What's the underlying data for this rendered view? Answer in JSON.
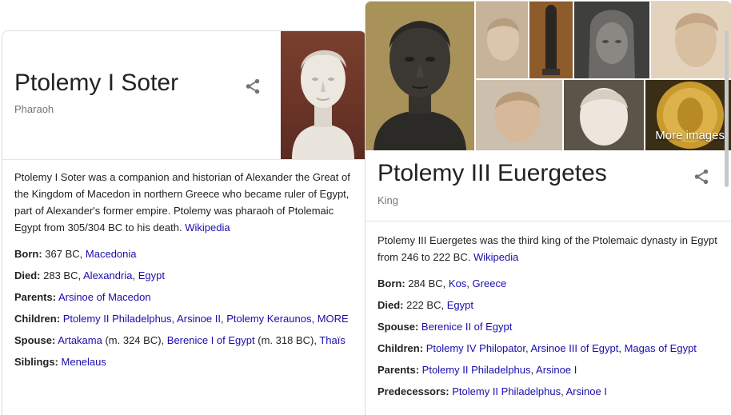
{
  "card1": {
    "title": "Ptolemy I Soter",
    "subtitle": "Pharaoh",
    "share_icon": "share-icon",
    "description": "Ptolemy I Soter was a companion and historian of Alexander the Great of the Kingdom of Macedon in northern Greece who became ruler of Egypt, part of Alexander's former empire. Ptolemy was pharaoh of Ptolemaic Egypt from 305/304 BC to his death.",
    "source_link": "Wikipedia",
    "born": {
      "label": "Born:",
      "text": "367 BC,",
      "links": [
        "Macedonia"
      ]
    },
    "died": {
      "label": "Died:",
      "text": "283 BC,",
      "links": [
        "Alexandria",
        "Egypt"
      ]
    },
    "parents": {
      "label": "Parents:",
      "links": [
        "Arsinoe of Macedon"
      ]
    },
    "children": {
      "label": "Children:",
      "links": [
        "Ptolemy II Philadelphus",
        "Arsinoe II",
        "Ptolemy Keraunos",
        "MORE"
      ]
    },
    "spouse": {
      "label": "Spouse:",
      "items": [
        {
          "link": "Artakama",
          "note": "(m. 324 BC),"
        },
        {
          "link": "Berenice I of Egypt",
          "note": "(m. 318 BC),"
        },
        {
          "link": "Thaïs",
          "note": ""
        }
      ]
    },
    "siblings": {
      "label": "Siblings:",
      "links": [
        "Menelaus"
      ]
    }
  },
  "card2": {
    "more_images": "More images",
    "title": "Ptolemy III Euergetes",
    "subtitle": "King",
    "description": "Ptolemy III Euergetes was the third king of the Ptolemaic dynasty in Egypt from 246 to 222 BC.",
    "source_link": "Wikipedia",
    "born": {
      "label": "Born:",
      "text": "284 BC,",
      "links": [
        "Kos",
        "Greece"
      ]
    },
    "died": {
      "label": "Died:",
      "text": "222 BC,",
      "links": [
        "Egypt"
      ]
    },
    "spouse": {
      "label": "Spouse:",
      "links": [
        "Berenice II of Egypt"
      ]
    },
    "children": {
      "label": "Children:",
      "links": [
        "Ptolemy IV Philopator",
        "Arsinoe III of Egypt",
        "Magas of Egypt"
      ]
    },
    "parents": {
      "label": "Parents:",
      "links": [
        "Ptolemy II Philadelphus",
        "Arsinoe I"
      ]
    },
    "predecessors": {
      "label": "Predecessors:",
      "links": [
        "Ptolemy II Philadelphus",
        "Arsinoe I"
      ]
    }
  },
  "colors": {
    "link": "#1a0dab",
    "title": "#222222",
    "muted": "#70757a"
  }
}
